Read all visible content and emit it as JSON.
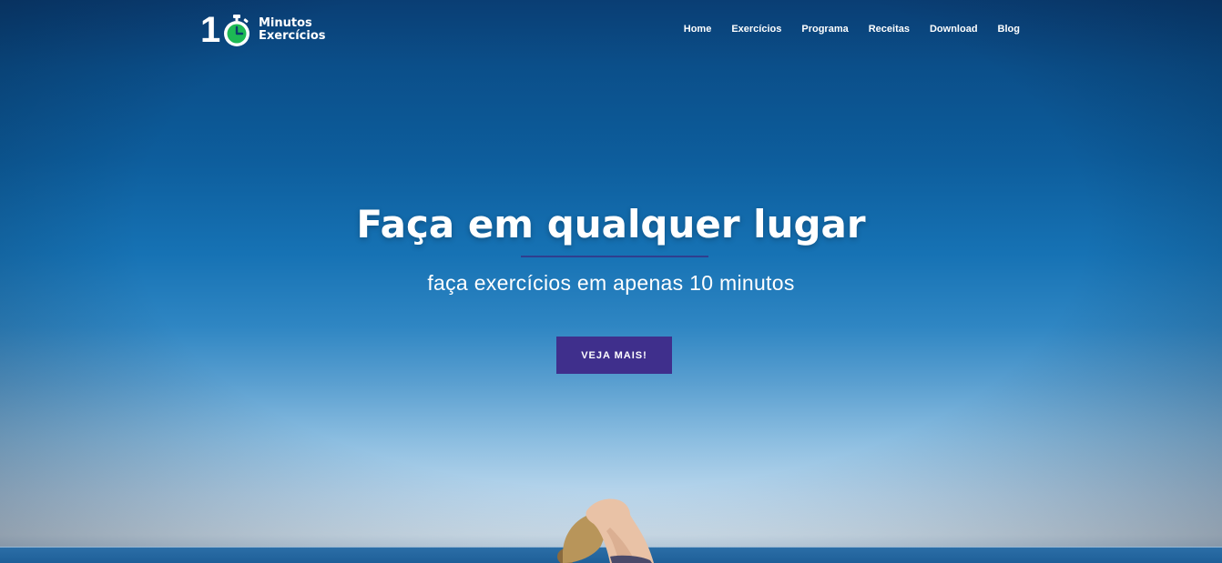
{
  "header": {
    "logo": {
      "number": "10",
      "line1": "Minutos",
      "line2": "Exercícios",
      "timer_color": "#1db954"
    },
    "nav": [
      {
        "label": "Home"
      },
      {
        "label": "Exercícios"
      },
      {
        "label": "Programa"
      },
      {
        "label": "Receitas"
      },
      {
        "label": "Download"
      },
      {
        "label": "Blog"
      }
    ]
  },
  "hero": {
    "title": "Faça em qualquer lugar",
    "subtitle": "faça exercícios em apenas 10 minutos",
    "cta_label": "VEJA MAIS!",
    "cta_color": "#3f2f8c",
    "divider_color": "#2f3f8f"
  }
}
